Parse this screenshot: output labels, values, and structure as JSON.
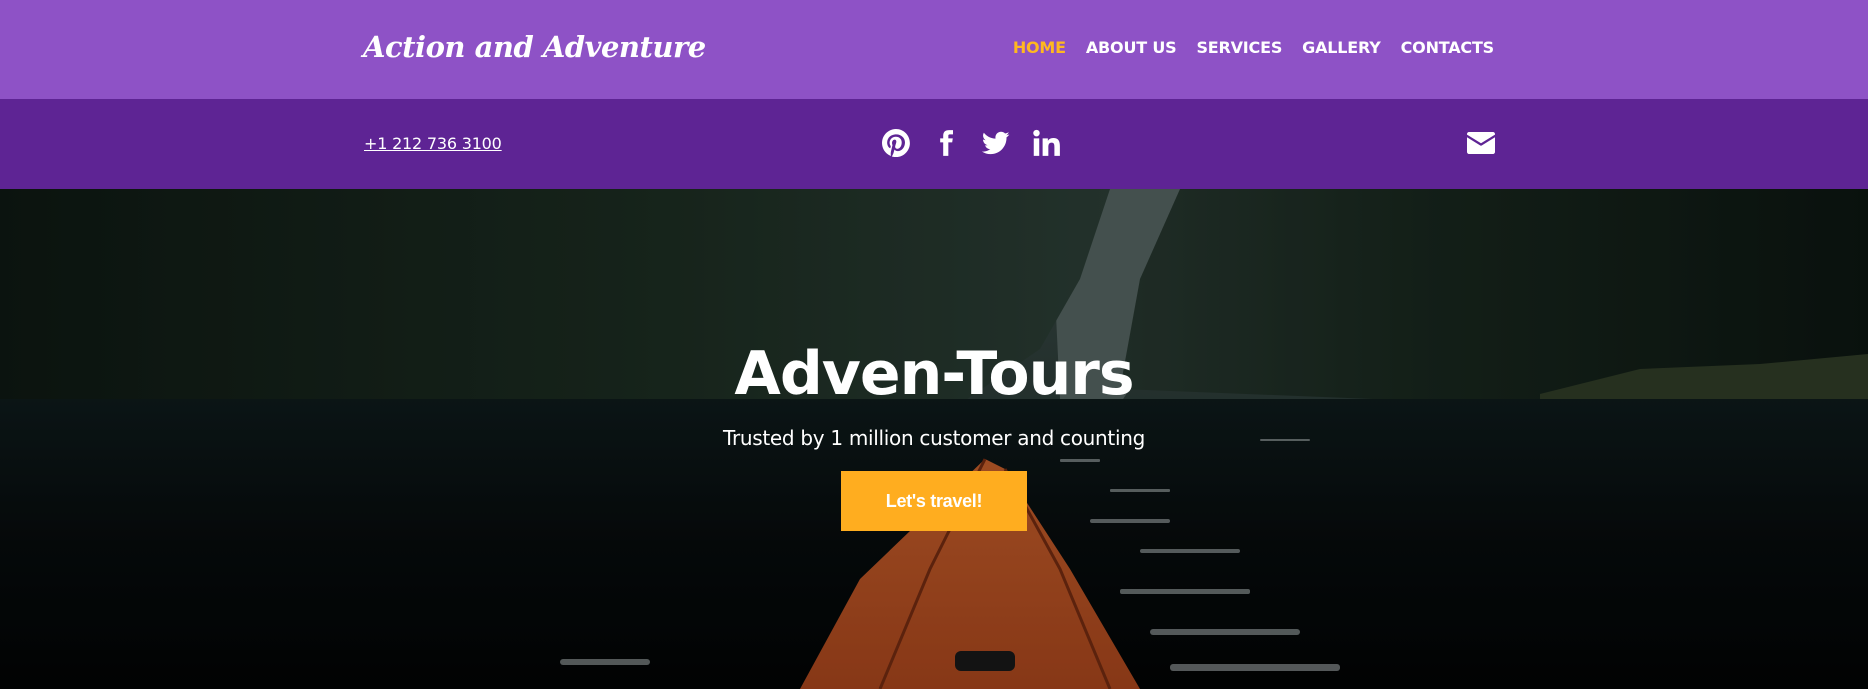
{
  "header": {
    "brand": "Action and Adventure",
    "nav": [
      {
        "label": "HOME",
        "active": true
      },
      {
        "label": "ABOUT US",
        "active": false
      },
      {
        "label": "SERVICES",
        "active": false
      },
      {
        "label": "GALLERY",
        "active": false
      },
      {
        "label": "CONTACTS",
        "active": false
      }
    ]
  },
  "contact_bar": {
    "phone": "+1 212 736 3100",
    "socials": [
      "pinterest-icon",
      "facebook-icon",
      "twitter-icon",
      "linkedin-icon"
    ],
    "mail_icon": "envelope-icon"
  },
  "hero": {
    "title": "Adven-Tours",
    "subtitle": "Trusted by 1 million customer and counting",
    "cta_label": "Let's travel!"
  },
  "colors": {
    "header_bg": "#8e52c6",
    "contact_bg": "#5e2494",
    "accent": "#ffad1f",
    "active_nav": "#ffb820"
  }
}
